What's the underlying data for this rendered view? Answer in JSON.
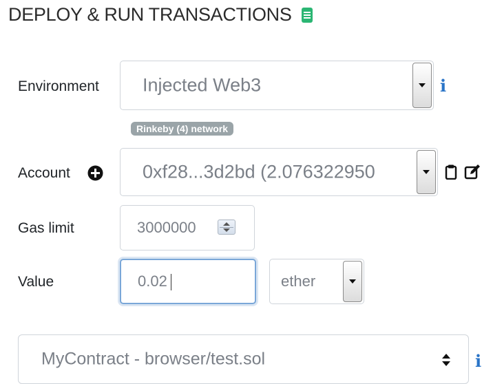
{
  "header": {
    "title": "DEPLOY & RUN TRANSACTIONS",
    "icon": "document-icon",
    "icon_color": "#2bb673"
  },
  "environment": {
    "label": "Environment",
    "value": "Injected Web3",
    "network_badge": "Rinkeby (4) network",
    "info_icon": "i"
  },
  "account": {
    "label": "Account",
    "value": "0xf28...3d2bd (2.076322950"
  },
  "gas_limit": {
    "label": "Gas limit",
    "value": "3000000"
  },
  "value": {
    "label": "Value",
    "amount": "0.02",
    "unit": "ether"
  },
  "contract": {
    "value": "MyContract - browser/test.sol",
    "info_icon": "i"
  }
}
